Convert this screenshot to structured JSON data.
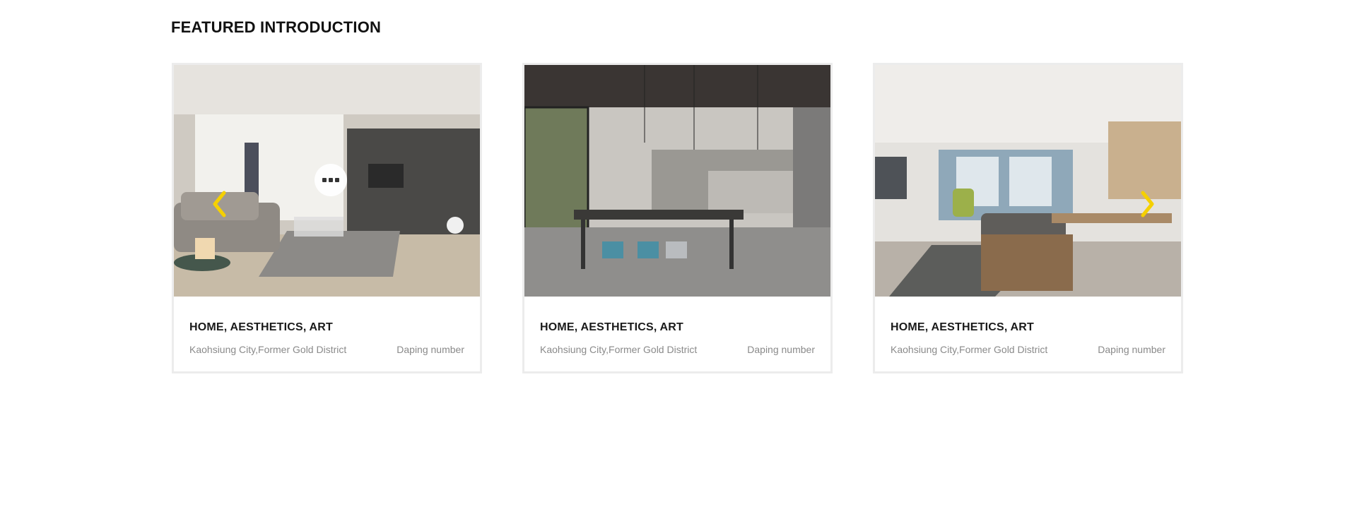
{
  "section": {
    "title": "FEATURED INTRODUCTION"
  },
  "cards": [
    {
      "title": "HOME, AESTHETICS, ART",
      "location": "Kaohsiung City,Former Gold District",
      "number": "Daping number",
      "image": "living-room-photo"
    },
    {
      "title": "HOME, AESTHETICS, ART",
      "location": "Kaohsiung City,Former Gold District",
      "number": "Daping number",
      "image": "dining-cafe-photo"
    },
    {
      "title": "HOME, AESTHETICS, ART",
      "location": "Kaohsiung City,Former Gold District",
      "number": "Daping number",
      "image": "open-living-dining-photo"
    }
  ],
  "carousel": {
    "prev_icon": "chevron-left-icon",
    "next_icon": "chevron-right-icon",
    "more_icon": "more-dots-icon"
  },
  "colors": {
    "accent": "#f5d000",
    "card_border": "#ececec",
    "meta_text": "#8a8a8a"
  }
}
